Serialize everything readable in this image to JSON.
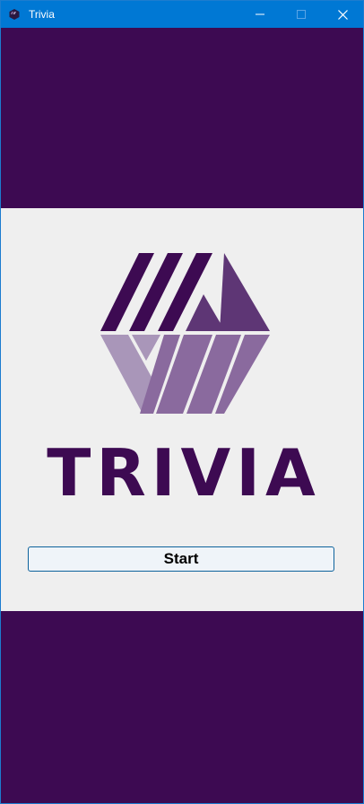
{
  "window": {
    "title": "Trivia",
    "icon": "app-icon",
    "controls": [
      "minimize-icon",
      "maximize-icon",
      "close-icon"
    ]
  },
  "logo": {
    "text": "TRIVIA",
    "colors": {
      "dark": "#3d0a52",
      "medium": "#5e3675",
      "light": "#8a6a9e",
      "pale": "#a996b9"
    }
  },
  "start_button": {
    "label": "Start"
  },
  "colors": {
    "background": "#3d0a52",
    "panel": "#efefef",
    "titlebar": "#0078d4",
    "button_border": "#0e639c"
  }
}
